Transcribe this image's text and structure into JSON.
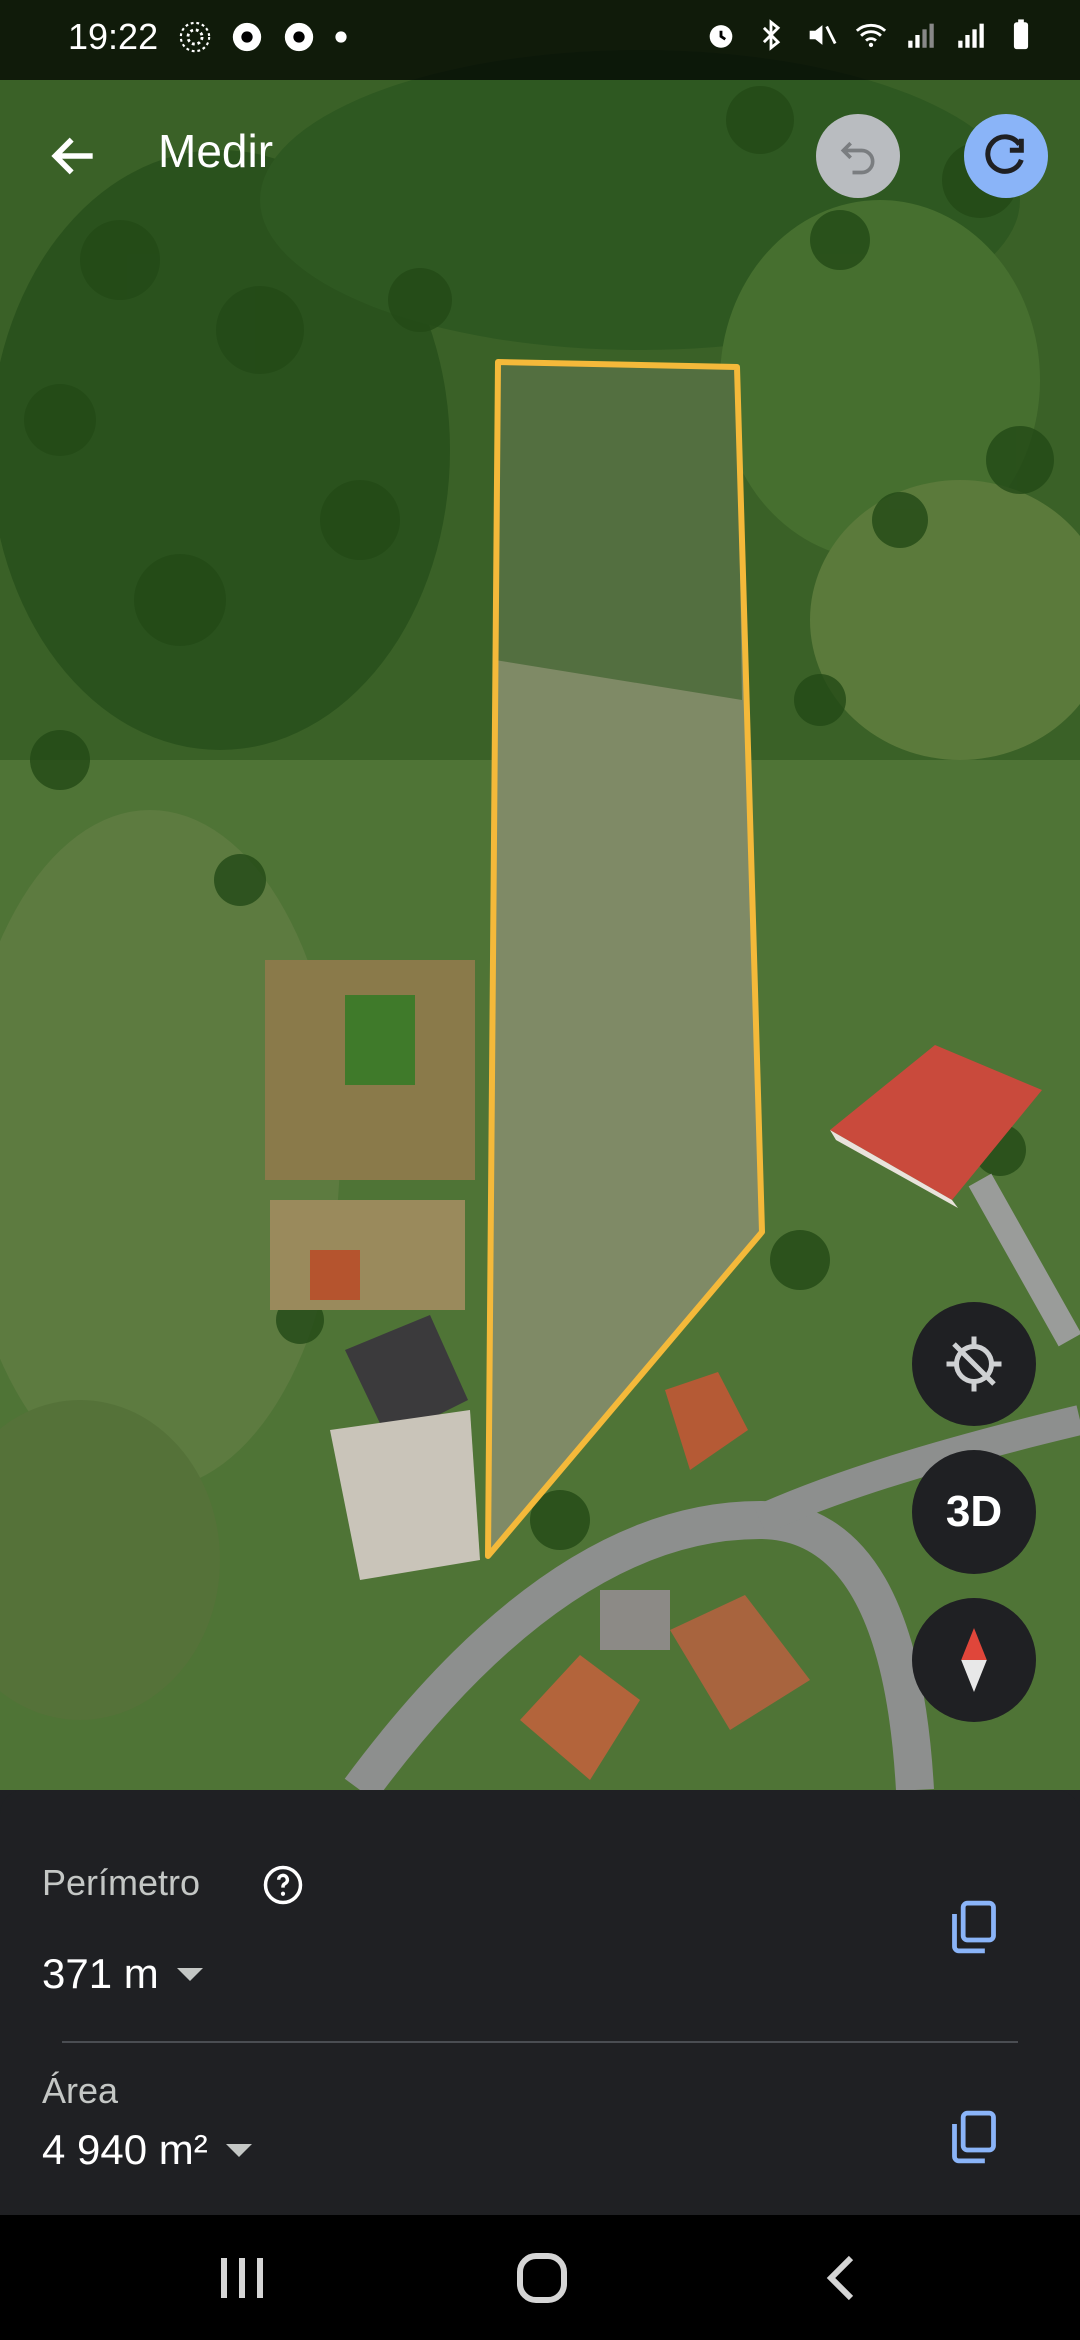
{
  "status_bar": {
    "time": "19:22"
  },
  "app_bar": {
    "title": "Medir"
  },
  "map": {
    "three_d_label": "3D",
    "outline_color": "#f4b93a"
  },
  "measurements": {
    "perimeter_label": "Perímetro",
    "perimeter_value": "371 m",
    "area_label": "Área",
    "area_value": "4 940 m²"
  },
  "colors": {
    "accent": "#8ab4f8",
    "sheet_bg": "#1f2023",
    "undo_disabled": "#b9bcc0"
  },
  "icons": [
    "back-arrow-icon",
    "undo-icon",
    "redo-icon",
    "location-off-icon",
    "compass-icon",
    "help-icon",
    "copy-icon",
    "recents-icon",
    "home-icon",
    "back-icon"
  ]
}
